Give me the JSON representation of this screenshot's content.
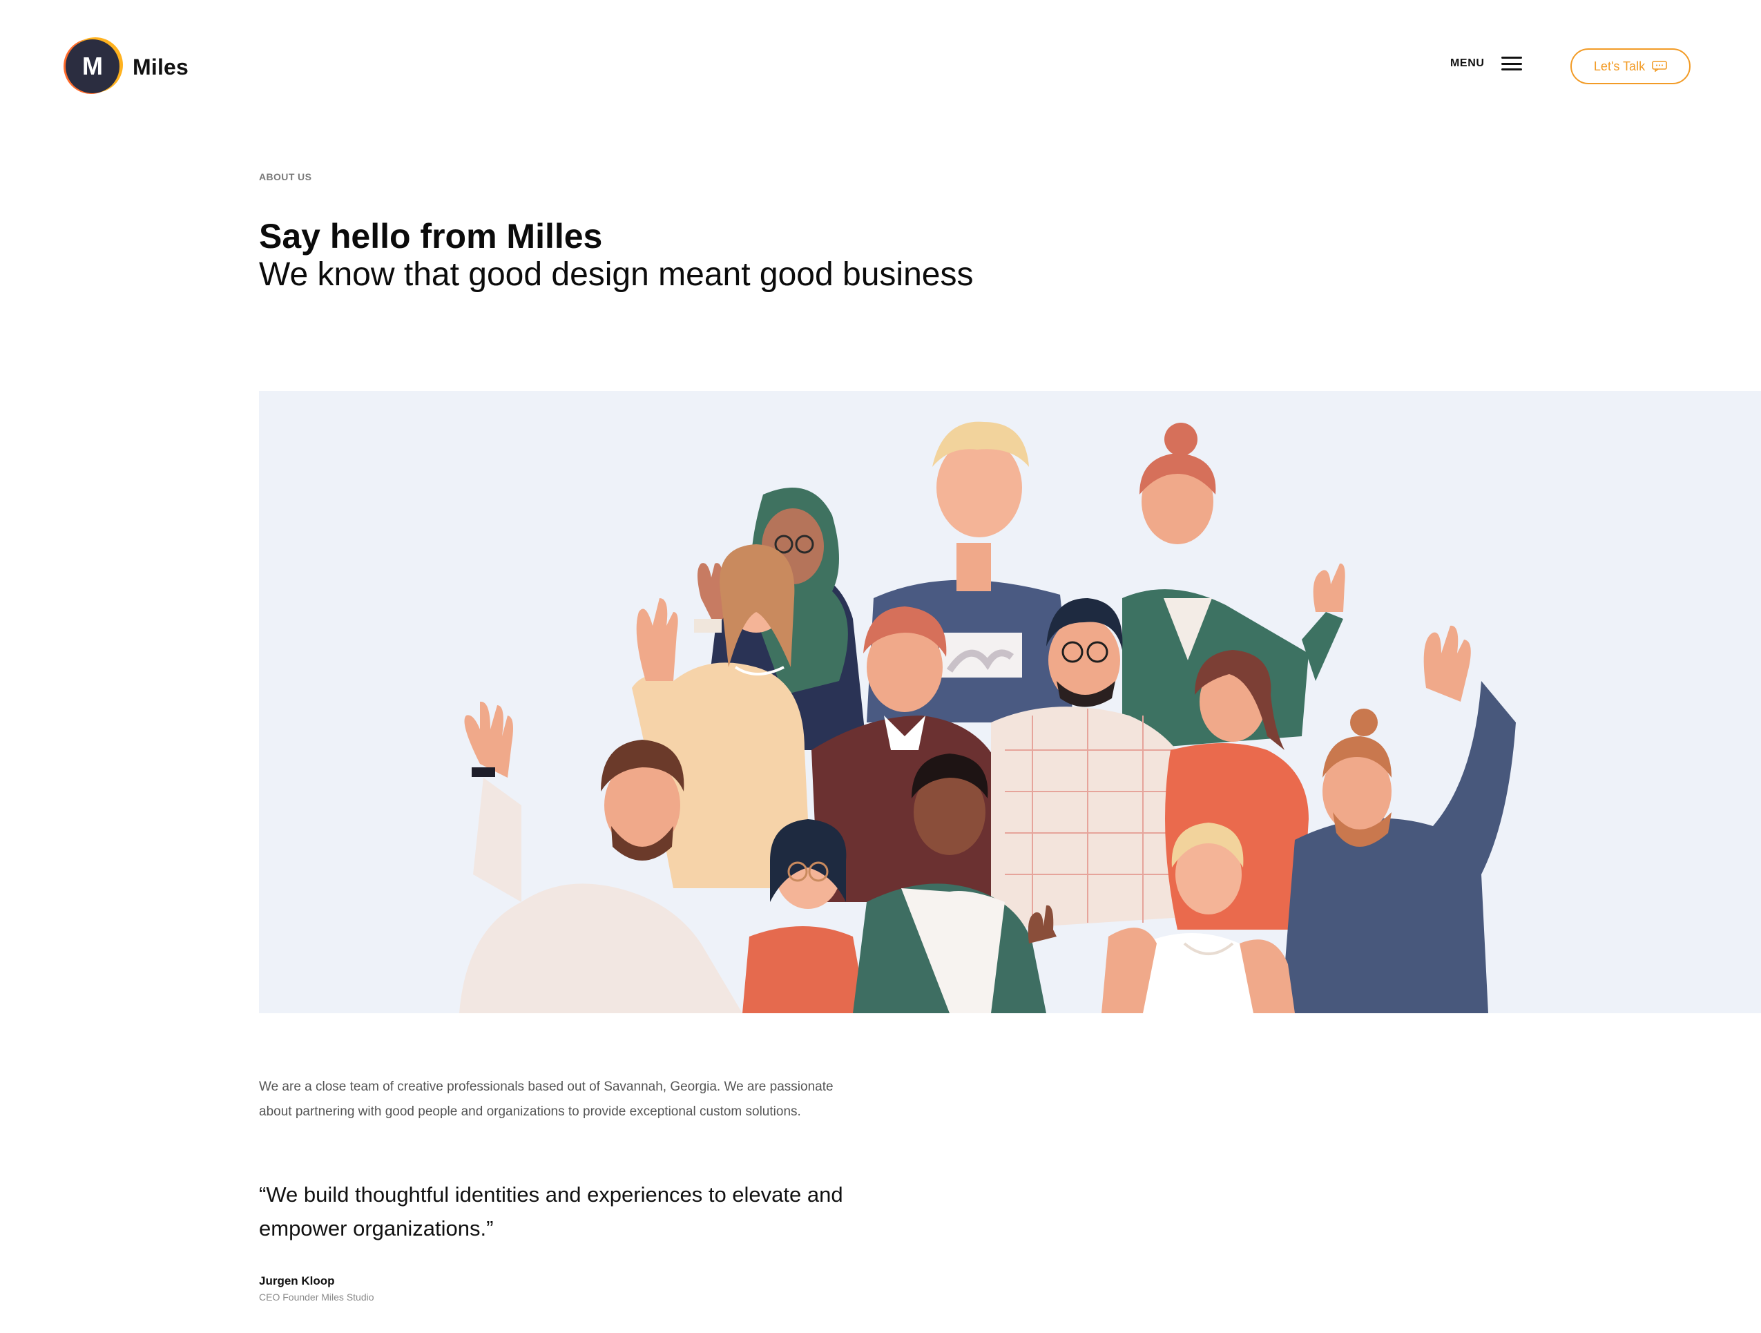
{
  "header": {
    "logo_letter": "M",
    "brand_name": "Miles",
    "menu_label": "MENU",
    "menu_icon": "hamburger-icon",
    "cta_label": "Let's Talk",
    "cta_icon": "chat-bubble-icon"
  },
  "intro": {
    "eyebrow": "ABOUT US",
    "title": "Say hello from Milles",
    "subtitle": "We know that good design meant good business"
  },
  "hero": {
    "image_alt": "Illustration of a diverse group of people waving",
    "background_color": "#eef2f9"
  },
  "about": {
    "body_line_1": "We are a close team of creative professionals based out of Savannah, Georgia. We are passionate",
    "body_line_2": "about partnering with good people and organizations to provide exceptional custom solutions.",
    "quote_line_1": "“We build thoughtful identities and experiences to elevate and",
    "quote_line_2": "empower organizations.”",
    "author_name": "Jurgen Kloop",
    "author_role": "CEO Founder Miles Studio"
  },
  "colors": {
    "accent": "#f29b26",
    "logo_dark": "#2b2d40",
    "logo_orange": "#ff6b2c",
    "logo_yellow": "#ffb21f",
    "body_text": "#555555"
  }
}
